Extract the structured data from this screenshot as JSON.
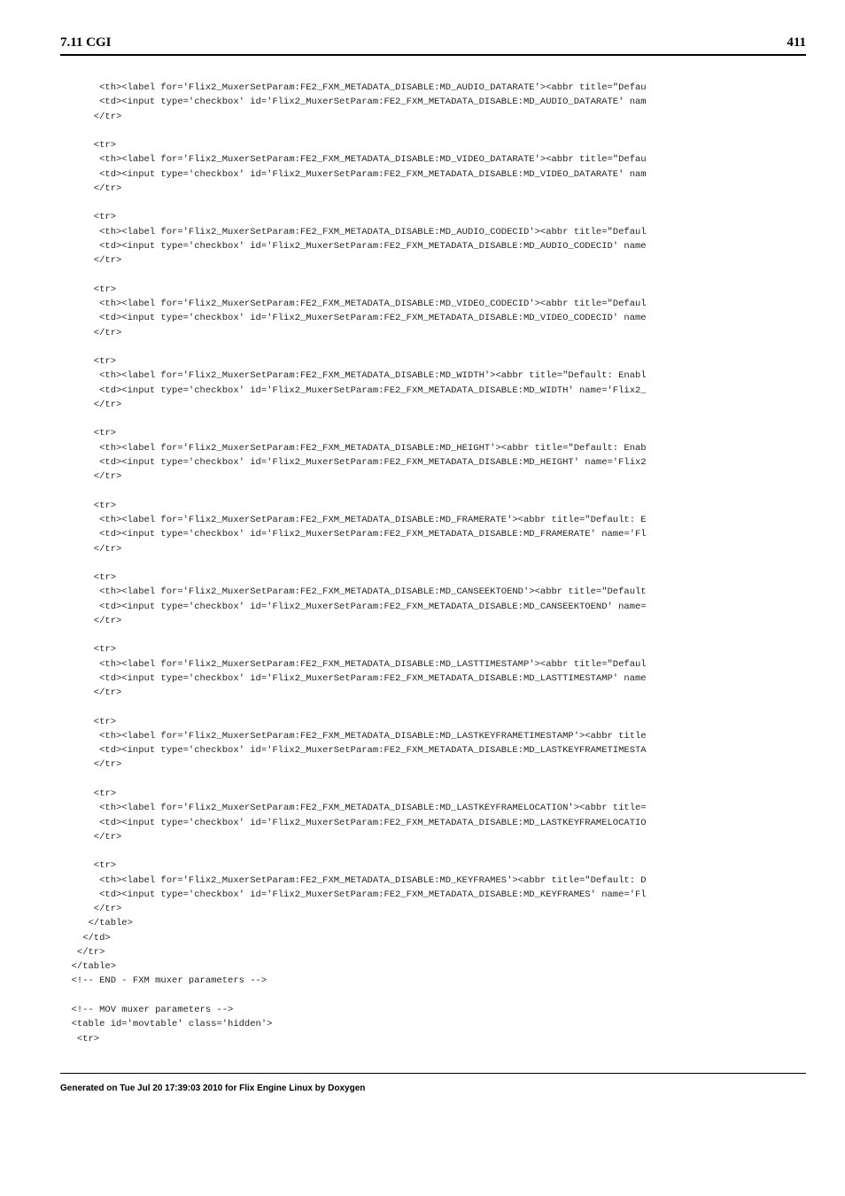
{
  "header": {
    "section": "7.11 CGI",
    "page_number": "411"
  },
  "footer": {
    "generated": "Generated on Tue Jul 20 17:39:03 2010 for Flix Engine Linux by Doxygen"
  },
  "code": {
    "lines": [
      "       <th><label for='Flix2_MuxerSetParam:FE2_FXM_METADATA_DISABLE:MD_AUDIO_DATARATE'><abbr title=\"Defau",
      "       <td><input type='checkbox' id='Flix2_MuxerSetParam:FE2_FXM_METADATA_DISABLE:MD_AUDIO_DATARATE' nam",
      "      </tr>",
      "",
      "      <tr>",
      "       <th><label for='Flix2_MuxerSetParam:FE2_FXM_METADATA_DISABLE:MD_VIDEO_DATARATE'><abbr title=\"Defau",
      "       <td><input type='checkbox' id='Flix2_MuxerSetParam:FE2_FXM_METADATA_DISABLE:MD_VIDEO_DATARATE' nam",
      "      </tr>",
      "",
      "      <tr>",
      "       <th><label for='Flix2_MuxerSetParam:FE2_FXM_METADATA_DISABLE:MD_AUDIO_CODECID'><abbr title=\"Defaul",
      "       <td><input type='checkbox' id='Flix2_MuxerSetParam:FE2_FXM_METADATA_DISABLE:MD_AUDIO_CODECID' name",
      "      </tr>",
      "",
      "      <tr>",
      "       <th><label for='Flix2_MuxerSetParam:FE2_FXM_METADATA_DISABLE:MD_VIDEO_CODECID'><abbr title=\"Defaul",
      "       <td><input type='checkbox' id='Flix2_MuxerSetParam:FE2_FXM_METADATA_DISABLE:MD_VIDEO_CODECID' name",
      "      </tr>",
      "",
      "      <tr>",
      "       <th><label for='Flix2_MuxerSetParam:FE2_FXM_METADATA_DISABLE:MD_WIDTH'><abbr title=\"Default: Enabl",
      "       <td><input type='checkbox' id='Flix2_MuxerSetParam:FE2_FXM_METADATA_DISABLE:MD_WIDTH' name='Flix2_",
      "      </tr>",
      "",
      "      <tr>",
      "       <th><label for='Flix2_MuxerSetParam:FE2_FXM_METADATA_DISABLE:MD_HEIGHT'><abbr title=\"Default: Enab",
      "       <td><input type='checkbox' id='Flix2_MuxerSetParam:FE2_FXM_METADATA_DISABLE:MD_HEIGHT' name='Flix2",
      "      </tr>",
      "",
      "      <tr>",
      "       <th><label for='Flix2_MuxerSetParam:FE2_FXM_METADATA_DISABLE:MD_FRAMERATE'><abbr title=\"Default: E",
      "       <td><input type='checkbox' id='Flix2_MuxerSetParam:FE2_FXM_METADATA_DISABLE:MD_FRAMERATE' name='Fl",
      "      </tr>",
      "",
      "      <tr>",
      "       <th><label for='Flix2_MuxerSetParam:FE2_FXM_METADATA_DISABLE:MD_CANSEEKTOEND'><abbr title=\"Default",
      "       <td><input type='checkbox' id='Flix2_MuxerSetParam:FE2_FXM_METADATA_DISABLE:MD_CANSEEKTOEND' name=",
      "      </tr>",
      "",
      "      <tr>",
      "       <th><label for='Flix2_MuxerSetParam:FE2_FXM_METADATA_DISABLE:MD_LASTTIMESTAMP'><abbr title=\"Defaul",
      "       <td><input type='checkbox' id='Flix2_MuxerSetParam:FE2_FXM_METADATA_DISABLE:MD_LASTTIMESTAMP' name",
      "      </tr>",
      "",
      "      <tr>",
      "       <th><label for='Flix2_MuxerSetParam:FE2_FXM_METADATA_DISABLE:MD_LASTKEYFRAMETIMESTAMP'><abbr title",
      "       <td><input type='checkbox' id='Flix2_MuxerSetParam:FE2_FXM_METADATA_DISABLE:MD_LASTKEYFRAMETIMESTA",
      "      </tr>",
      "",
      "      <tr>",
      "       <th><label for='Flix2_MuxerSetParam:FE2_FXM_METADATA_DISABLE:MD_LASTKEYFRAMELOCATION'><abbr title=",
      "       <td><input type='checkbox' id='Flix2_MuxerSetParam:FE2_FXM_METADATA_DISABLE:MD_LASTKEYFRAMELOCATIO",
      "      </tr>",
      "",
      "      <tr>",
      "       <th><label for='Flix2_MuxerSetParam:FE2_FXM_METADATA_DISABLE:MD_KEYFRAMES'><abbr title=\"Default: D",
      "       <td><input type='checkbox' id='Flix2_MuxerSetParam:FE2_FXM_METADATA_DISABLE:MD_KEYFRAMES' name='Fl",
      "      </tr>",
      "     </table>",
      "    </td>",
      "   </tr>",
      "  </table>",
      "  <!-- END - FXM muxer parameters -->",
      "",
      "  <!-- MOV muxer parameters -->",
      "  <table id='movtable' class='hidden'>",
      "   <tr>"
    ]
  }
}
